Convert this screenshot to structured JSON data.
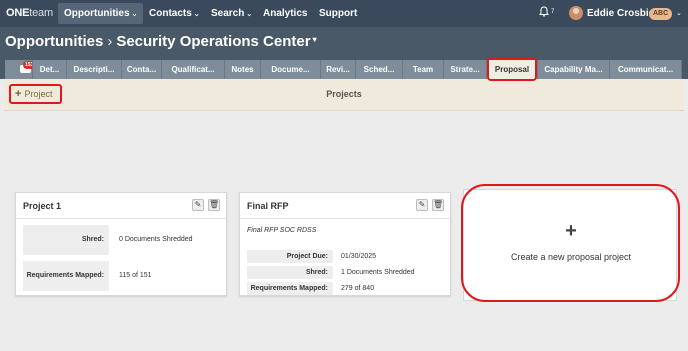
{
  "topnav": {
    "logo_one": "ONE",
    "logo_team": "team",
    "items": [
      {
        "label": "Opportunities",
        "caret": "⌄"
      },
      {
        "label": "Contacts",
        "caret": "⌄"
      },
      {
        "label": "Search",
        "caret": "⌄"
      },
      {
        "label": "Analytics"
      },
      {
        "label": "Support"
      }
    ],
    "notification_count": "7",
    "user_name": "Eddie Crosbie",
    "user_badge": "ABC",
    "user_caret": "⌄"
  },
  "breadcrumb": {
    "section": "Opportunities",
    "separator": "›",
    "current": "Security Operations Center",
    "caret": "▾"
  },
  "tabs": {
    "chat_badge": "153",
    "items": [
      "Det...",
      "Descripti...",
      "Conta...",
      "Qualificat...",
      "Notes",
      "Docume...",
      "Revi...",
      "Sched...",
      "Team",
      "Strate...",
      "Proposal",
      "Capability Ma...",
      "Communicat..."
    ],
    "active": "Proposal"
  },
  "projects_bar": {
    "add_label": "Project",
    "add_icon": "+",
    "title": "Projects"
  },
  "cards": [
    {
      "title": "Project 1",
      "rows": [
        {
          "label": "Shred:",
          "value": "0 Documents Shredded"
        },
        {
          "label": "Requirements Mapped:",
          "value": "115 of 151"
        }
      ]
    },
    {
      "title": "Final RFP",
      "subtitle": "Final RFP SOC RDSS",
      "rows": [
        {
          "label": "Project Due:",
          "value": "01/30/2025"
        },
        {
          "label": "Shred:",
          "value": "1 Documents Shredded"
        },
        {
          "label": "Requirements Mapped:",
          "value": "279 of 840"
        }
      ]
    }
  ],
  "create": {
    "icon": "+",
    "label": "Create a new proposal project"
  },
  "icons": {
    "edit": "✎",
    "delete": "🗑"
  },
  "colors": {
    "nav_bg": "#3a4a5c",
    "highlight": "#e0181b",
    "active_tab": "#f1ede2"
  }
}
